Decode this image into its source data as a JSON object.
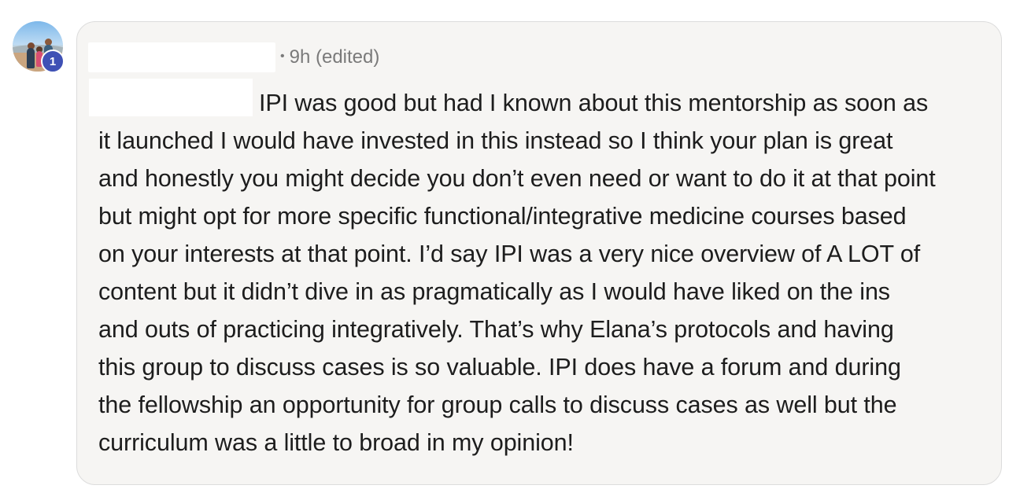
{
  "comment": {
    "author_name": "",
    "avatar": {
      "icon": "profile-photo-icon",
      "badge_count": "1",
      "badge_color": "#3f51b5"
    },
    "time_separator": "•",
    "timestamp": "9h (edited)",
    "mention": "",
    "body_lines": [
      "IPI was good but had I known about this mentorship as soon as",
      "it launched I would have invested in this instead so I think your plan is great",
      "and honestly you might decide you don’t even need or want to do it at that point",
      "but might opt for more specific functional/integrative medicine courses based",
      "on your interests at that point. I’d say IPI was a very nice overview of A LOT of",
      "content but it didn’t dive in as pragmatically as I would have liked on the ins",
      "and outs of practicing integratively. That’s why Elana’s protocols and having",
      "this group to discuss cases is so valuable. IPI does have a forum and during",
      "the fellowship an opportunity for group calls to discuss cases as well but the",
      "curriculum was a little to broad in my opinion!"
    ],
    "colors": {
      "bubble_background": "#f6f5f3",
      "bubble_border": "#dcdcdc",
      "text": "#1d1d1d",
      "meta_text": "#7a7a7a"
    }
  }
}
